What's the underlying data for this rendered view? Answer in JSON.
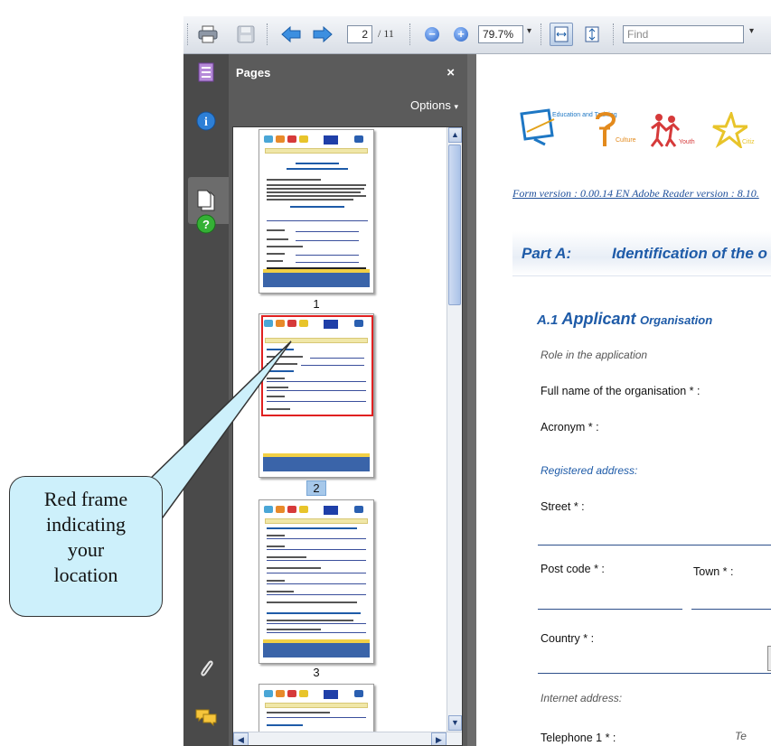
{
  "toolbar": {
    "page_current": "2",
    "page_total": "/ 11",
    "zoom": "79.7%",
    "find_placeholder": "Find"
  },
  "nav": {
    "icons": [
      "pages-icon",
      "info-icon",
      "document-icon",
      "help-icon",
      "attachment-icon",
      "comments-icon"
    ]
  },
  "pages_panel": {
    "title": "Pages",
    "close": "×",
    "options": "Options",
    "thumbnails": [
      "1",
      "2",
      "3"
    ],
    "selected_page": "2"
  },
  "document": {
    "logo_education": "Education and Training",
    "logo_culture": "Culture",
    "logo_youth": "Youth",
    "logo_citizens": "Citiz",
    "form_version": "Form version : 0.00.14 EN  Adobe Reader version : 8.10.",
    "part_label": "Part A:",
    "part_title": "Identification of the o",
    "section_num": "A.1 ",
    "section_title": "Applicant",
    "section_sub": "Organisation",
    "role_label": "Role in the application",
    "fullname_label": "Full name of the organisation * :",
    "acronym_label": "Acronym * :",
    "registered_label": "Registered address:",
    "street_label": "Street * :",
    "postcode_label": "Post code * :",
    "town_label": "Town * :",
    "country_label": "Country * :",
    "internet_label": "Internet address:",
    "telephone_label": "Telephone 1 * :",
    "te_label": "Te"
  },
  "callout": {
    "lines": [
      "Red frame",
      "indicating",
      "your",
      "location"
    ]
  },
  "colors": {
    "panel_bg": "#5b5b5b",
    "nav_bg": "#4a4a4a",
    "heading_blue": "#1e5ba8",
    "red_frame": "#e02020",
    "callout_fill": "#cdf0fb"
  }
}
